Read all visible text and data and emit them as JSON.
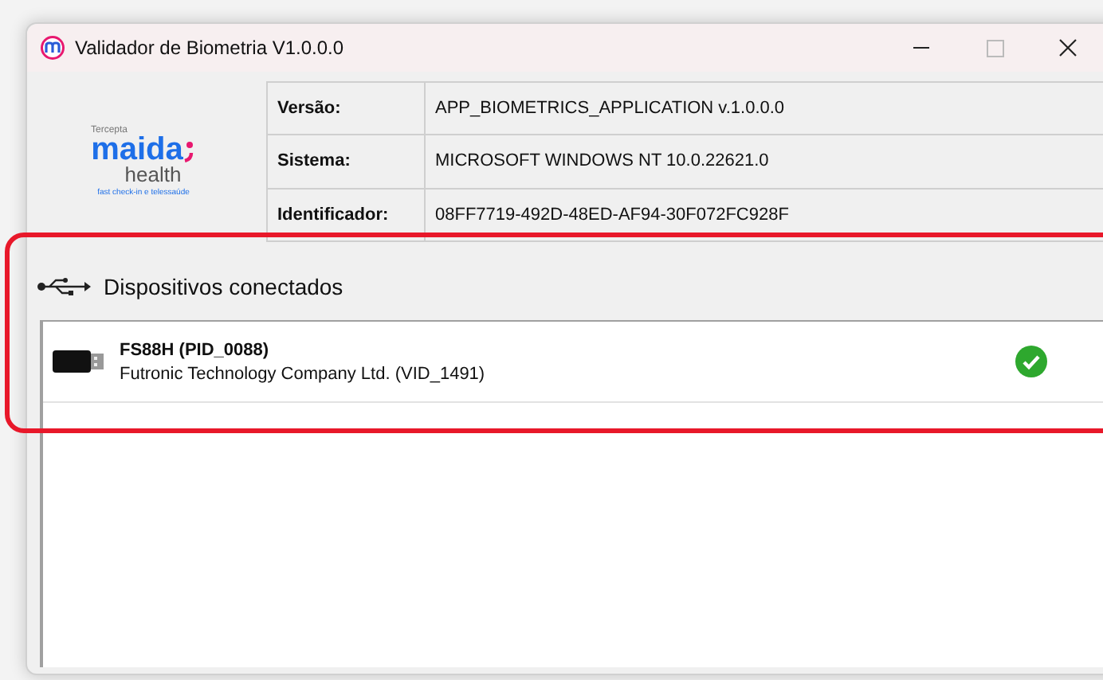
{
  "window": {
    "title": "Validador de Biometria V1.0.0.0"
  },
  "logo": {
    "tagline_top": "Tercepta",
    "brand": "maida",
    "brand_sub": "health",
    "tagline": "fast check-in e telessaúde"
  },
  "info": [
    {
      "label": "Versão:",
      "value": "APP_BIOMETRICS_APPLICATION v.1.0.0.0"
    },
    {
      "label": "Sistema:",
      "value": "MICROSOFT WINDOWS NT 10.0.22621.0"
    },
    {
      "label": "Identificador:",
      "value": "08FF7719-492D-48ED-AF94-30F072FC928F"
    }
  ],
  "devices_section": {
    "title": "Dispositivos conectados"
  },
  "devices": [
    {
      "name": "FS88H (PID_0088)",
      "vendor": "Futronic Technology Company Ltd. (VID_1491)",
      "connected": true
    }
  ]
}
